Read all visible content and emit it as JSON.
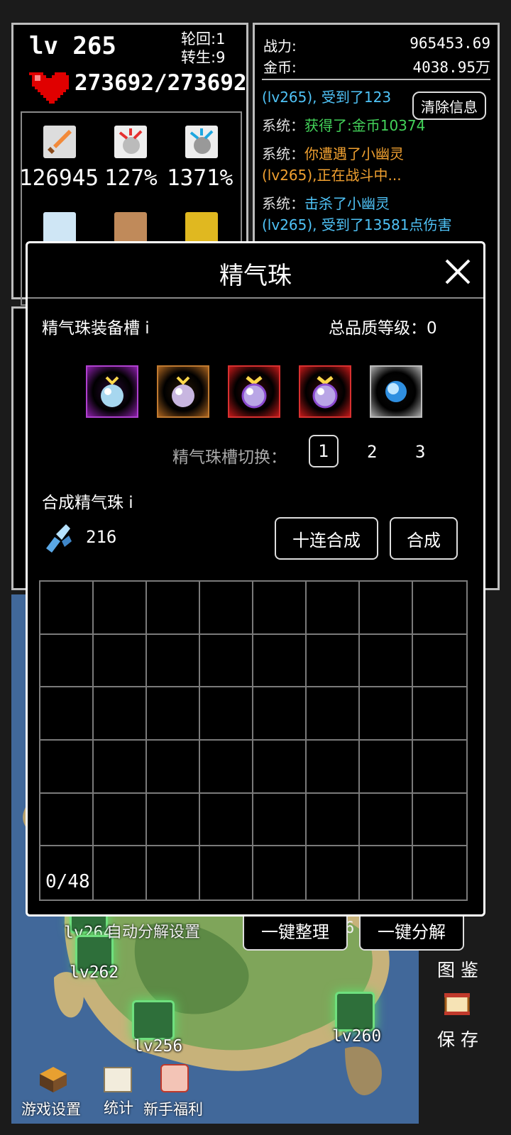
{
  "player": {
    "level": "lv 265",
    "lunhui": "轮回:1",
    "zhuansheng": "转生:9",
    "hp": "273692/273692"
  },
  "stats": {
    "attack": "126945",
    "crit_rate": "127%",
    "crit_dmg": "1371%"
  },
  "combat": {
    "power_label": "战力:",
    "power_value": "965453.69",
    "gold_label": "金币:",
    "gold_value": "4038.95万"
  },
  "log": {
    "clear_button": "清除信息",
    "lines": [
      {
        "text": "(lv265), 受到了123",
        "color": "#4fc3f7"
      },
      {
        "prefix": "系统：",
        "text": "获得了:金币10374",
        "color": "#43d35a"
      },
      {
        "prefix": "系统：",
        "text": "你遭遇了小幽灵",
        "color": "#f0a030"
      },
      {
        "text": "(lv265),正在战斗中...",
        "color": "#f0a030"
      },
      {
        "prefix": "系统：",
        "text": "击杀了小幽灵",
        "color": "#4fc3f7"
      },
      {
        "text": "(lv265), 受到了13581点伤害",
        "color": "#4fc3f7"
      }
    ]
  },
  "dialog": {
    "title": "精气珠",
    "slot_section": "精气珠装备槽 i",
    "total_quality": "总品质等级：0",
    "switch_label": "精气珠槽切换：",
    "switch_options": [
      "1",
      "2",
      "3"
    ],
    "combine_section": "合成精气珠 i",
    "material_count": "216",
    "combine10_button": "十连合成",
    "combine_button": "合成",
    "capacity": "0/48"
  },
  "bottom_actions": {
    "sort_button": "一键整理",
    "decompose_button": "一键分解",
    "auto_decompose": "自动分解设置"
  },
  "map_markers": [
    "lv264",
    "lv262",
    "lv256",
    "lv260"
  ],
  "map_fragment": "6",
  "side_menu": {
    "codex": "图 鉴",
    "save": "保 存"
  },
  "bottom_menu": {
    "settings": "游戏设置",
    "stats": "统计",
    "newbie": "新手福利"
  },
  "colors": {
    "purple_slot": "#8a1fa8",
    "orange_slot": "#a8621e",
    "red_slot": "#c01818",
    "log_blue": "#4fc3f7",
    "log_green": "#43d35a",
    "log_orange": "#f0a030"
  },
  "icons": [
    "heart-icon",
    "sword-icon",
    "crit-rate-icon",
    "crit-damage-icon",
    "shield-icon",
    "armor-icon",
    "gold-medal-icon",
    "close-icon",
    "crystal-icon",
    "orb-icon",
    "scroll-icon",
    "chest-icon",
    "gift-icon"
  ]
}
